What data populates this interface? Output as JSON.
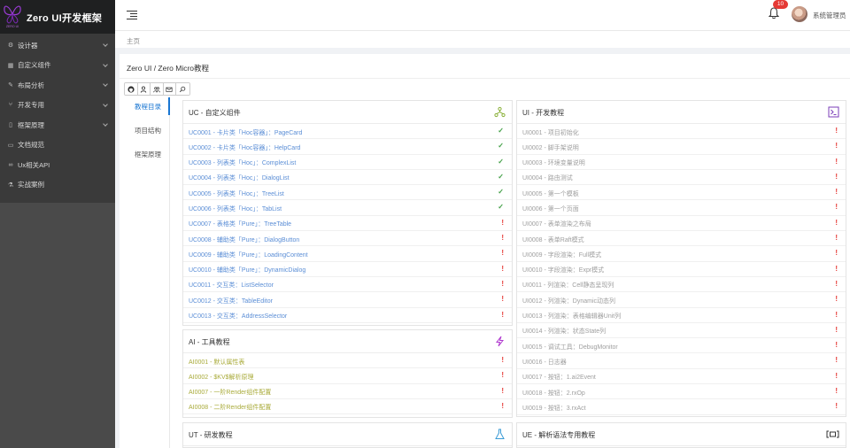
{
  "app": {
    "title": "Zero UI开发框架",
    "logo_caption": "ZERO UI"
  },
  "sidebar": {
    "items": [
      {
        "label": "设计器",
        "icon": "gear-icon",
        "glyph": "⚙"
      },
      {
        "label": "自定义组件",
        "icon": "table-icon",
        "glyph": "▦"
      },
      {
        "label": "布局分析",
        "icon": "pencil-icon",
        "glyph": "✎"
      },
      {
        "label": "开发专用",
        "icon": "fork-icon",
        "glyph": "⑂"
      },
      {
        "label": "框架原理",
        "icon": "columns-icon",
        "glyph": "▯"
      },
      {
        "label": "文档规范",
        "icon": "document-icon",
        "glyph": "▭"
      },
      {
        "label": "Ux相关API",
        "icon": "link-icon",
        "glyph": "∞"
      },
      {
        "label": "实战案例",
        "icon": "flask-icon",
        "glyph": "⚗"
      }
    ]
  },
  "header": {
    "notification_count": "10",
    "username": "系统管理员"
  },
  "breadcrumb": {
    "home": "主页"
  },
  "page": {
    "title": "Zero UI / Zero Micro教程"
  },
  "tabs": [
    {
      "label": "教程目录",
      "active": true
    },
    {
      "label": "项目结构",
      "active": false
    },
    {
      "label": "框架原理",
      "active": false
    }
  ],
  "colors": {
    "sidebar_bg": "#3a3a3a",
    "accent": "#1976d2",
    "badge": "#e53935",
    "ok": "#43a047",
    "warn": "#e53935"
  },
  "cards": {
    "uc": {
      "title": "UC - 自定义组件",
      "icon": "sitemap-icon",
      "rows": [
        {
          "text": "UC0001 - 卡片类「Hoc容器」：PageCard",
          "status": "ok"
        },
        {
          "text": "UC0002 - 卡片类「Hoc容器」：HelpCard",
          "status": "ok"
        },
        {
          "text": "UC0003 - 列表类「Hoc」：ComplexList",
          "status": "ok"
        },
        {
          "text": "UC0004 - 列表类「Hoc」：DialogList",
          "status": "ok"
        },
        {
          "text": "UC0005 - 列表类「Hoc」：TreeList",
          "status": "ok"
        },
        {
          "text": "UC0006 - 列表类「Hoc」：TabList",
          "status": "ok"
        },
        {
          "text": "UC0007 - 表格类「Pure」：TreeTable",
          "status": "warn"
        },
        {
          "text": "UC0008 - 辅助类「Pure」：DialogButton",
          "status": "warn"
        },
        {
          "text": "UC0009 - 辅助类「Pure」：LoadingContent",
          "status": "warn"
        },
        {
          "text": "UC0010 - 辅助类「Pure」：DynamicDialog",
          "status": "warn"
        },
        {
          "text": "UC0011 - 交互类：ListSelector",
          "status": "warn"
        },
        {
          "text": "UC0012 - 交互类：TableEditor",
          "status": "warn"
        },
        {
          "text": "UC0013 - 交互类：AddressSelector",
          "status": "warn"
        }
      ]
    },
    "ui": {
      "title": "UI - 开发教程",
      "icon": "terminal-icon",
      "rows": [
        {
          "text": "UI0001 - 项目初始化",
          "status": "warn"
        },
        {
          "text": "UI0002 - 脚手架说明",
          "status": "warn"
        },
        {
          "text": "UI0003 - 环境变量说明",
          "status": "warn"
        },
        {
          "text": "UI0004 - 路由测试",
          "status": "warn"
        },
        {
          "text": "UI0005 - 第一个模板",
          "status": "warn"
        },
        {
          "text": "UI0006 - 第一个页面",
          "status": "warn"
        },
        {
          "text": "UI0007 - 表单渲染之布局",
          "status": "warn"
        },
        {
          "text": "UI0008 - 表单Raft模式",
          "status": "warn"
        },
        {
          "text": "UI0009 - 字段渲染：Full模式",
          "status": "warn"
        },
        {
          "text": "UI0010 - 字段渲染：Expr模式",
          "status": "warn"
        },
        {
          "text": "UI0011 - 列渲染：Cell静态呈现列",
          "status": "warn"
        },
        {
          "text": "UI0012 - 列渲染：Dynamic动态列",
          "status": "warn"
        },
        {
          "text": "UI0013 - 列渲染：表格编辑器Unit列",
          "status": "warn"
        },
        {
          "text": "UI0014 - 列渲染：状态State列",
          "status": "warn"
        },
        {
          "text": "UI0015 - 调试工具：DebugMonitor",
          "status": "warn"
        },
        {
          "text": "UI0016 - 日志器",
          "status": "warn"
        },
        {
          "text": "UI0017 - 按钮：1.ai2Event",
          "status": "warn"
        },
        {
          "text": "UI0018 - 按钮：2.rxOp",
          "status": "warn"
        },
        {
          "text": "UI0019 - 按钮：3.rxAct",
          "status": "warn"
        }
      ]
    },
    "ai": {
      "title": "AI - 工具教程",
      "icon": "lightning-icon",
      "rows": [
        {
          "text": "AI0001 - 默认属性表",
          "status": "warn"
        },
        {
          "text": "AI0002 - $KV$解析原理",
          "status": "warn"
        },
        {
          "text": "AI0007 - 一阶Render组件配置",
          "status": "warn"
        },
        {
          "text": "AI0008 - 二阶Render组件配置",
          "status": "warn"
        }
      ]
    },
    "ut": {
      "title": "UT - 研发教程",
      "icon": "flask-icon"
    },
    "ue": {
      "title": "UE - 解析语法专用教程",
      "icon": "code-brackets-icon"
    }
  }
}
